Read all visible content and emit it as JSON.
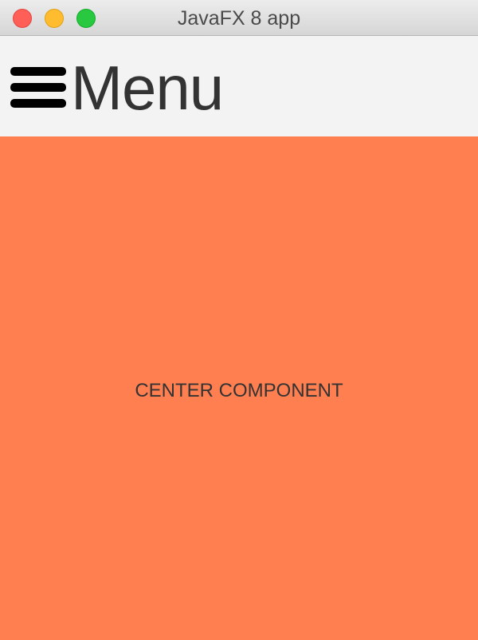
{
  "window": {
    "title": "JavaFX 8 app",
    "controls": [
      "close-button",
      "minimize-button",
      "zoom-button"
    ]
  },
  "menubar": {
    "icon": "hamburger-icon",
    "label": "Menu",
    "background": "#f3f3f3"
  },
  "center": {
    "label": "CENTER COMPONENT",
    "background": "#ff7f50"
  }
}
